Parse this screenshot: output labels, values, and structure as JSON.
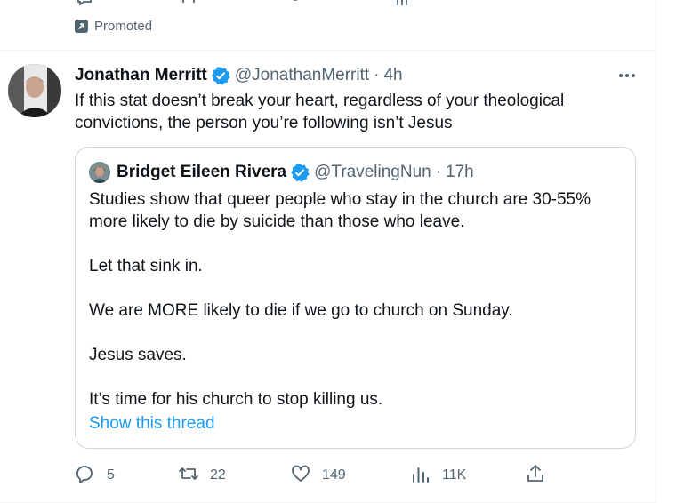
{
  "promoted": {
    "label": "Promoted"
  },
  "tweet": {
    "author_name": "Jonathan Merritt",
    "handle": "@JonathanMerritt",
    "separator": "·",
    "time": "4h",
    "text": "If this stat doesn’t break your heart, regardless of your theological convictions, the person you’re following isn’t Jesus"
  },
  "quote": {
    "author_name": "Bridget Eileen Rivera",
    "handle": "@TravelingNun",
    "separator": "·",
    "time": "17h",
    "paragraphs": [
      "Studies show that queer people who stay in the church are 30-55% more likely to die by suicide than those who leave.",
      "Let that sink in.",
      "We are MORE likely to die if we go to church on Sunday.",
      "Jesus saves.",
      "It’s time for his church to stop killing us."
    ],
    "show_thread": "Show this thread"
  },
  "actions": {
    "replies": "5",
    "retweets": "22",
    "likes": "149",
    "views": "11K"
  },
  "icons": {
    "verified": "verified-badge-icon",
    "more": "more-icon",
    "reply": "reply-icon",
    "retweet": "retweet-icon",
    "like": "heart-icon",
    "views": "views-icon",
    "share": "share-icon"
  },
  "colors": {
    "accent": "#1d9bf0",
    "muted": "#536471",
    "border": "#cfd9de"
  }
}
